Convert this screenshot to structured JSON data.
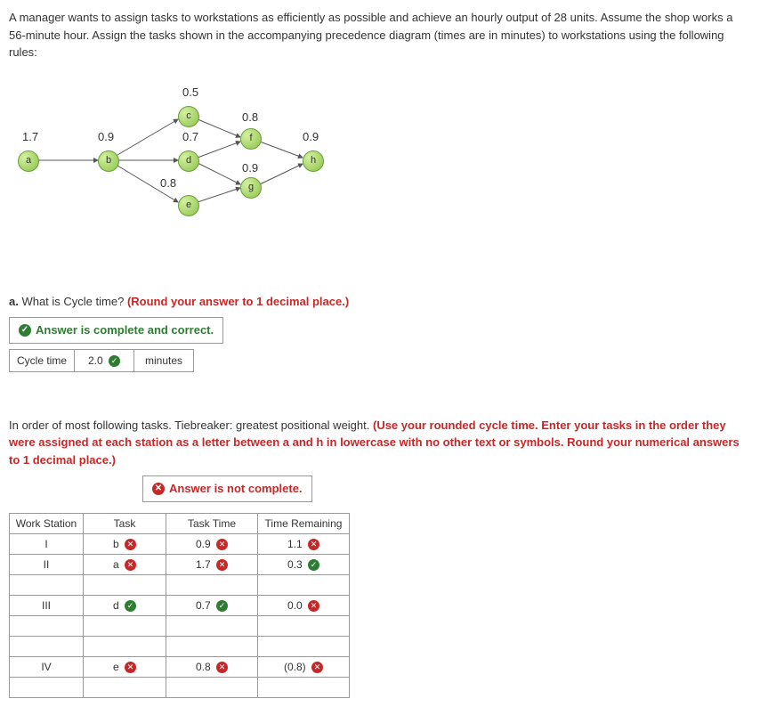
{
  "problem": "A manager wants to assign tasks to workstations as efficiently as possible and achieve an hourly output of 28 units. Assume the shop works a 56-minute hour. Assign the tasks shown in the accompanying precedence diagram (times are in minutes) to workstations using the following rules:",
  "nodes": {
    "a": {
      "label": "a",
      "time": "1.7"
    },
    "b": {
      "label": "b",
      "time": "0.9"
    },
    "c": {
      "label": "c",
      "time": "0.5"
    },
    "d": {
      "label": "d",
      "time": "0.7"
    },
    "e": {
      "label": "e",
      "time": "0.8"
    },
    "f": {
      "label": "f",
      "time": "0.8"
    },
    "g": {
      "label": "g",
      "time": "0.9"
    },
    "h": {
      "label": "h",
      "time": "0.9"
    }
  },
  "qa": {
    "prefix": "a.",
    "text": " What is Cycle time? ",
    "hint": "(Round your answer to 1 decimal place.)"
  },
  "feedback_correct": "Answer is complete and correct.",
  "cycle": {
    "label": "Cycle time",
    "value": "2.0",
    "unit": "minutes"
  },
  "instr2": {
    "lead": "In order of most following tasks. Tiebreaker: greatest positional weight. ",
    "hint": "(Use your rounded cycle time. Enter your tasks in the order they were assigned at each station as a letter between a and h in lowercase with no other text or symbols. Round your numerical answers to 1 decimal place.)"
  },
  "feedback_incomplete": "Answer is not complete.",
  "headers": {
    "ws": "Work Station",
    "task": "Task",
    "tt": "Task Time",
    "tr": "Time Remaining"
  },
  "rows": [
    {
      "ws": "I",
      "task": "b",
      "task_ok": false,
      "tt": "0.9",
      "tt_ok": false,
      "tr": "1.1",
      "tr_ok": false
    },
    {
      "ws": "II",
      "task": "a",
      "task_ok": false,
      "tt": "1.7",
      "tt_ok": false,
      "tr": "0.3",
      "tr_ok": true
    },
    {
      "ws": "",
      "task": "",
      "task_ok": null,
      "tt": "",
      "tt_ok": null,
      "tr": "",
      "tr_ok": null
    },
    {
      "ws": "III",
      "task": "d",
      "task_ok": true,
      "tt": "0.7",
      "tt_ok": true,
      "tr": "0.0",
      "tr_ok": false
    },
    {
      "ws": "",
      "task": "",
      "task_ok": null,
      "tt": "",
      "tt_ok": null,
      "tr": "",
      "tr_ok": null
    },
    {
      "ws": "",
      "task": "",
      "task_ok": null,
      "tt": "",
      "tt_ok": null,
      "tr": "",
      "tr_ok": null
    },
    {
      "ws": "IV",
      "task": "e",
      "task_ok": false,
      "tt": "0.8",
      "tt_ok": false,
      "tr": "(0.8)",
      "tr_ok": false
    },
    {
      "ws": "",
      "task": "",
      "task_ok": null,
      "tt": "",
      "tt_ok": null,
      "tr": "",
      "tr_ok": null
    }
  ]
}
